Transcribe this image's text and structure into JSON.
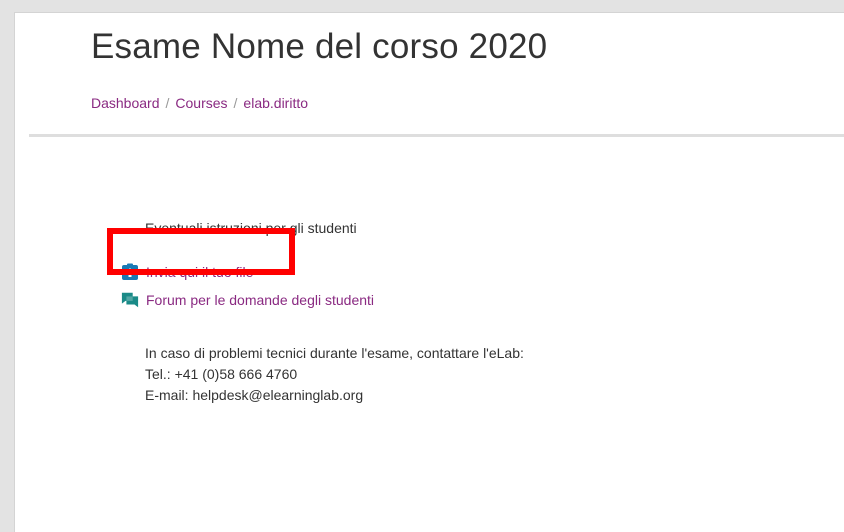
{
  "header": {
    "title": "Esame Nome del corso 2020",
    "breadcrumb": [
      {
        "label": "Dashboard"
      },
      {
        "label": "Courses"
      },
      {
        "label": "elab.diritto"
      }
    ],
    "separator": "/"
  },
  "section": {
    "intro_text": "Eventuali istruzioni per gli studenti",
    "activities": [
      {
        "label": "Invia qui il tuo file",
        "icon": "assignment-upload-icon"
      },
      {
        "label": "Forum per le domande degli studenti",
        "icon": "forum-icon"
      }
    ],
    "contact": {
      "line1": "In caso di problemi tecnici durante l'esame, contattare l'eLab:",
      "line2": "Tel.: +41 (0)58 666 4760",
      "line3": "E-mail: helpdesk@elearninglab.org"
    }
  },
  "colors": {
    "link": "#8a2a82",
    "highlight": "#ff0000",
    "assignment_icon": "#1a7bb5",
    "forum_icon": "#1a8a87"
  }
}
